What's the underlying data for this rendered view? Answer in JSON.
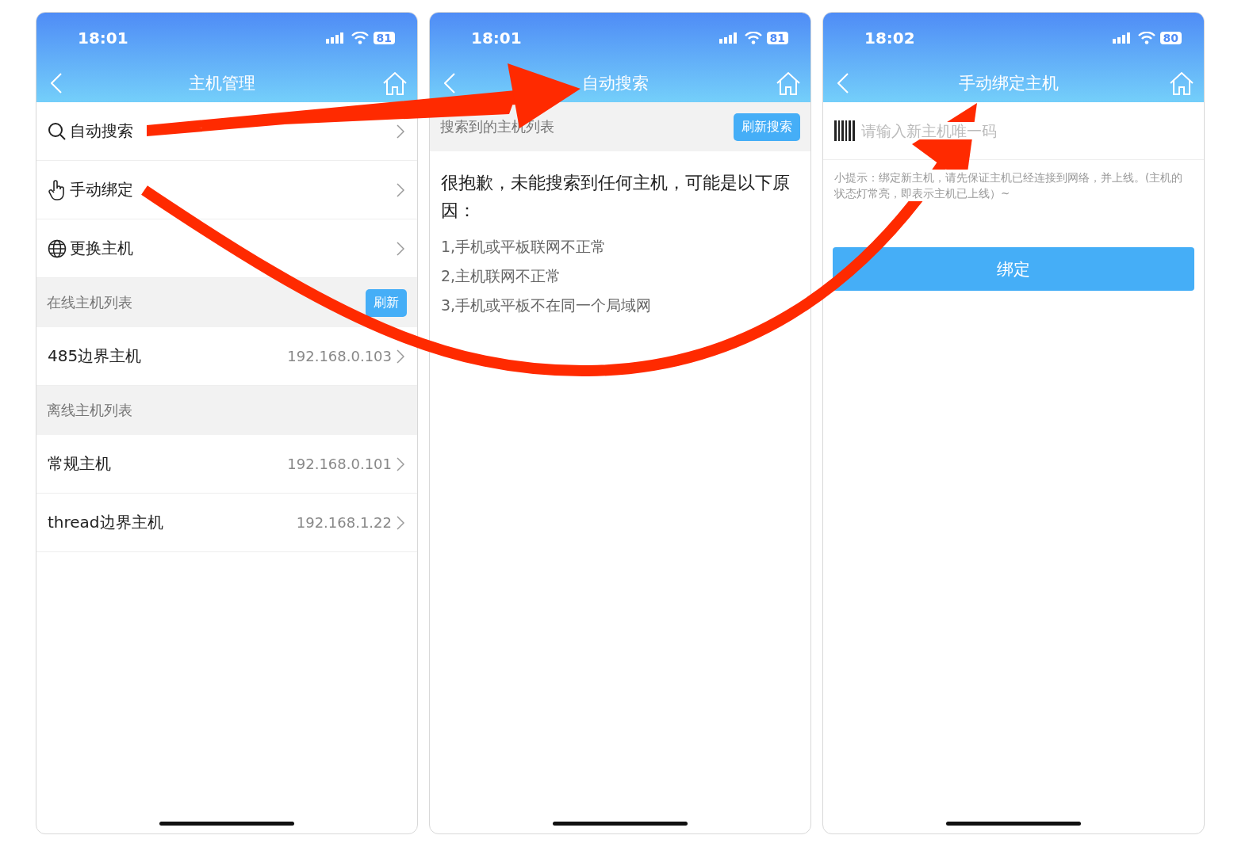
{
  "screens": [
    {
      "kind": "host-list",
      "status_bar": {
        "time": "18:01",
        "battery": "81"
      },
      "nav": {
        "title": "主机管理"
      },
      "menu": [
        {
          "kind": "search",
          "label": "自动搜索"
        },
        {
          "kind": "hand",
          "label": "手动绑定"
        },
        {
          "kind": "globe",
          "label": "更换主机"
        }
      ],
      "sections": [
        {
          "title": "在线主机列表",
          "button": "刷新",
          "hosts": [
            {
              "name": "485边界主机",
              "ip": "192.168.0.103"
            }
          ]
        },
        {
          "title": "离线主机列表",
          "hosts": [
            {
              "name": "常规主机",
              "ip": "192.168.0.101"
            },
            {
              "name": "thread边界主机",
              "ip": "192.168.1.22"
            }
          ]
        }
      ]
    },
    {
      "kind": "auto-search",
      "status_bar": {
        "time": "18:01",
        "battery": "81"
      },
      "nav": {
        "title": "自动搜索"
      },
      "section": {
        "title": "搜索到的主机列表",
        "button": "刷新搜索"
      },
      "message": "很抱歉，未能搜索到任何主机，可能是以下原因：",
      "reasons": [
        "1,手机或平板联网不正常",
        "2,主机联网不正常",
        "3,手机或平板不在同一个局域网"
      ]
    },
    {
      "kind": "manual-bind",
      "status_bar": {
        "time": "18:02",
        "battery": "80"
      },
      "nav": {
        "title": "手动绑定主机"
      },
      "field": {
        "placeholder": "请输入新主机唯一码"
      },
      "hint": "小提示：绑定新主机，请先保证主机已经连接到网络，并上线。(主机的状态灯常亮，即表示主机已上线）~",
      "button": "绑定"
    }
  ]
}
